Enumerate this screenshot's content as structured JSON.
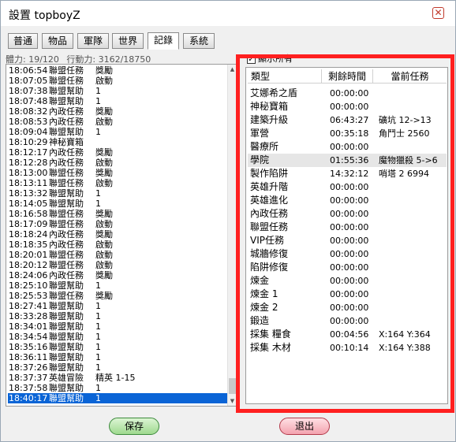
{
  "window": {
    "title": "設置 topboyZ",
    "close_label": "✕"
  },
  "tabs": [
    {
      "label": "普通"
    },
    {
      "label": "物品"
    },
    {
      "label": "軍隊"
    },
    {
      "label": "世界"
    },
    {
      "label": "記錄"
    },
    {
      "label": "系統"
    }
  ],
  "active_tab": "記錄",
  "stats": {
    "stamina": "體力: 19/120",
    "action": "行動力: 3162/18750"
  },
  "log": [
    {
      "time": "18:06:54",
      "event": "聯盟任務",
      "detail": "獎勵"
    },
    {
      "time": "18:07:05",
      "event": "聯盟任務",
      "detail": "啟動"
    },
    {
      "time": "18:07:38",
      "event": "聯盟幫助",
      "detail": "1"
    },
    {
      "time": "18:07:48",
      "event": "聯盟幫助",
      "detail": "1"
    },
    {
      "time": "18:08:32",
      "event": "內政任務",
      "detail": "獎勵"
    },
    {
      "time": "18:08:53",
      "event": "內政任務",
      "detail": "啟動"
    },
    {
      "time": "18:09:04",
      "event": "聯盟幫助",
      "detail": "1"
    },
    {
      "time": "18:10:29",
      "event": "神秘寶箱",
      "detail": ""
    },
    {
      "time": "18:12:17",
      "event": "內政任務",
      "detail": "獎勵"
    },
    {
      "time": "18:12:28",
      "event": "內政任務",
      "detail": "啟動"
    },
    {
      "time": "18:13:00",
      "event": "聯盟任務",
      "detail": "獎勵"
    },
    {
      "time": "18:13:11",
      "event": "聯盟任務",
      "detail": "啟動"
    },
    {
      "time": "18:13:32",
      "event": "聯盟幫助",
      "detail": "1"
    },
    {
      "time": "18:14:05",
      "event": "聯盟幫助",
      "detail": "1"
    },
    {
      "time": "18:16:58",
      "event": "聯盟任務",
      "detail": "獎勵"
    },
    {
      "time": "18:17:09",
      "event": "聯盟任務",
      "detail": "啟動"
    },
    {
      "time": "18:18:24",
      "event": "內政任務",
      "detail": "獎勵"
    },
    {
      "time": "18:18:35",
      "event": "內政任務",
      "detail": "啟動"
    },
    {
      "time": "18:20:01",
      "event": "聯盟任務",
      "detail": "啟動"
    },
    {
      "time": "18:20:12",
      "event": "聯盟任務",
      "detail": "啟動"
    },
    {
      "time": "18:24:06",
      "event": "內政任務",
      "detail": "獎勵"
    },
    {
      "time": "18:25:10",
      "event": "聯盟幫助",
      "detail": "1"
    },
    {
      "time": "18:25:53",
      "event": "聯盟任務",
      "detail": "獎勵"
    },
    {
      "time": "18:27:41",
      "event": "聯盟幫助",
      "detail": "1"
    },
    {
      "time": "18:33:28",
      "event": "聯盟幫助",
      "detail": "1"
    },
    {
      "time": "18:34:01",
      "event": "聯盟幫助",
      "detail": "1"
    },
    {
      "time": "18:34:54",
      "event": "聯盟幫助",
      "detail": "1"
    },
    {
      "time": "18:35:16",
      "event": "聯盟幫助",
      "detail": "1"
    },
    {
      "time": "18:36:11",
      "event": "聯盟幫助",
      "detail": "1"
    },
    {
      "time": "18:37:26",
      "event": "聯盟幫助",
      "detail": "1"
    },
    {
      "time": "18:37:37",
      "event": "英雄冒險",
      "detail": "精英 1-15"
    },
    {
      "time": "18:37:58",
      "event": "聯盟幫助",
      "detail": "1"
    },
    {
      "time": "18:40:17",
      "event": "聯盟幫助",
      "detail": "1"
    }
  ],
  "selected_log_index": 32,
  "show_all": {
    "label": "顯示所有",
    "checked": true
  },
  "table": {
    "headers": [
      "類型",
      "剩餘時間",
      "當前任務"
    ],
    "rows": [
      {
        "type": "艾娜希之盾",
        "time": "00:00:00",
        "task": ""
      },
      {
        "type": "神秘寶箱",
        "time": "00:00:00",
        "task": ""
      },
      {
        "type": "建築升級",
        "time": "06:43:27",
        "task": "礦坑 12->13"
      },
      {
        "type": "軍營",
        "time": "00:35:18",
        "task": "角鬥士 2560"
      },
      {
        "type": "醫療所",
        "time": "00:00:00",
        "task": ""
      },
      {
        "type": "學院",
        "time": "01:55:36",
        "task": "魔物獵殺 5->6"
      },
      {
        "type": "製作陷阱",
        "time": "14:32:12",
        "task": "哨塔 2 6994"
      },
      {
        "type": "英雄升階",
        "time": "00:00:00",
        "task": ""
      },
      {
        "type": "英雄進化",
        "time": "00:00:00",
        "task": ""
      },
      {
        "type": "內政任務",
        "time": "00:00:00",
        "task": ""
      },
      {
        "type": "聯盟任務",
        "time": "00:00:00",
        "task": ""
      },
      {
        "type": "VIP任務",
        "time": "00:00:00",
        "task": ""
      },
      {
        "type": "城牆修復",
        "time": "00:00:00",
        "task": ""
      },
      {
        "type": "陷阱修復",
        "time": "00:00:00",
        "task": ""
      },
      {
        "type": "煉金",
        "time": "00:00:00",
        "task": ""
      },
      {
        "type": "煉金 1",
        "time": "00:00:00",
        "task": ""
      },
      {
        "type": "煉金 2",
        "time": "00:00:00",
        "task": ""
      },
      {
        "type": "鍛造",
        "time": "00:00:00",
        "task": ""
      },
      {
        "type": "採集 糧食",
        "time": "00:04:56",
        "task": "X:164 Y:364"
      },
      {
        "type": "採集 木材",
        "time": "00:10:14",
        "task": "X:164 Y:388"
      }
    ],
    "highlighted_row": 5
  },
  "buttons": {
    "save": "保存",
    "exit": "退出"
  },
  "colors": {
    "highlight_frame": "#ff2020",
    "selection": "#0a64d6"
  }
}
